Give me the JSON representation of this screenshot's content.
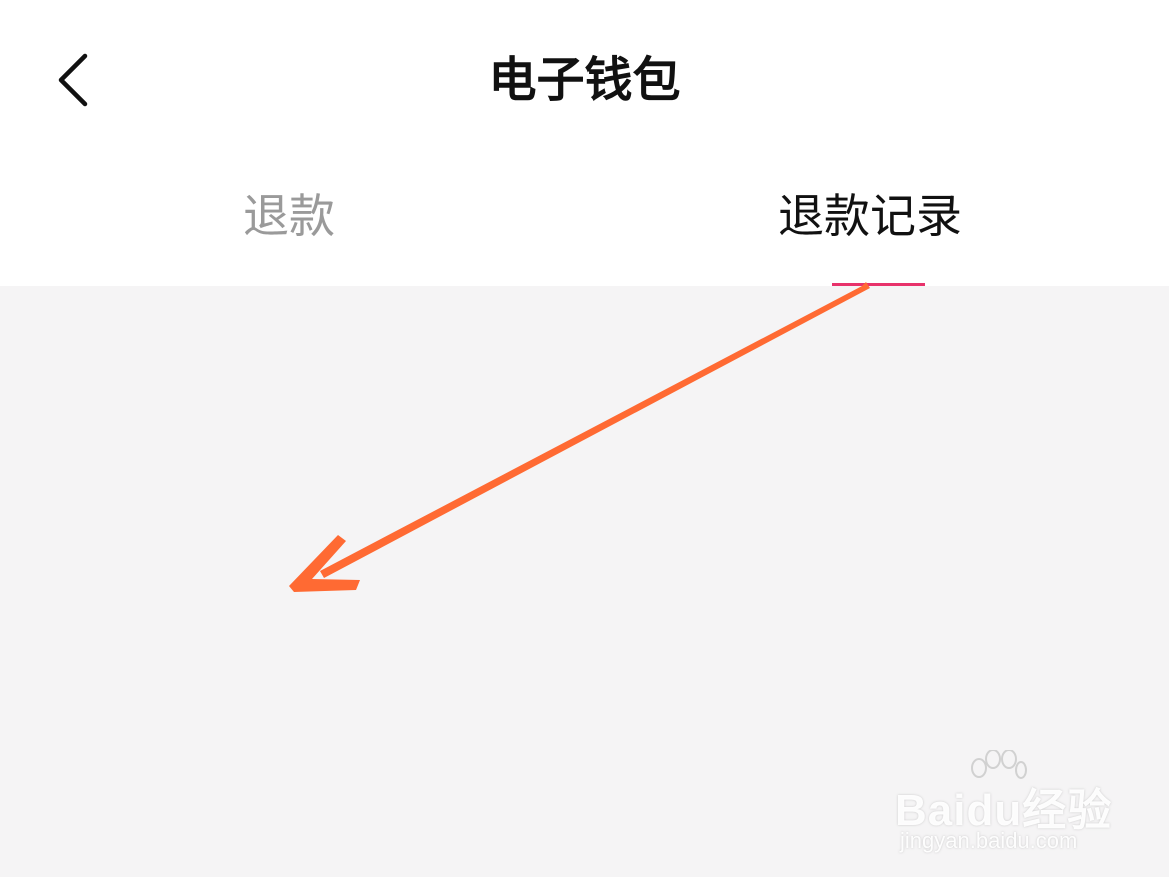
{
  "header": {
    "title": "电子钱包",
    "back_icon": "chevron-left-icon"
  },
  "tabs": [
    {
      "label": "退款",
      "active": false
    },
    {
      "label": "退款记录",
      "active": true
    }
  ],
  "colors": {
    "tab_indicator": "#e8326b",
    "annotation_arrow": "#ff6a33",
    "content_background": "#f5f4f5"
  },
  "watermark": {
    "logo_text": "Baidu经验",
    "url": "jingyan.baidu.com"
  }
}
